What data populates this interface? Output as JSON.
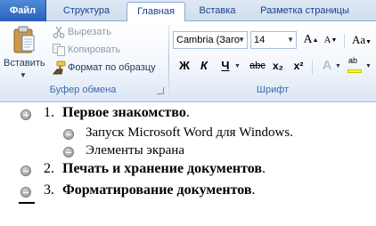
{
  "tabs": {
    "file": "Файл",
    "structure": "Структура",
    "home": "Главная",
    "insert": "Вставка",
    "page_layout": "Разметка страницы"
  },
  "clipboard": {
    "paste_label": "Вставить",
    "cut_label": "Вырезать",
    "copy_label": "Копировать",
    "format_painter_label": "Формат по образцу",
    "group_label": "Буфер обмена"
  },
  "font": {
    "font_name": "Cambria (Заго",
    "font_size": "14",
    "grow_label": "A",
    "shrink_label": "A",
    "case_label": "Aa",
    "bold_label": "Ж",
    "italic_label": "К",
    "underline_label": "Ч",
    "strike_label": "abc",
    "subscript_label": "x₂",
    "superscript_label": "x²",
    "effects_label": "A",
    "highlight_label": "ab",
    "group_label": "Шрифт"
  },
  "colors": {
    "accent": "#2a62bd",
    "highlight": "#ffff00"
  },
  "document": {
    "items": [
      {
        "num": "1.",
        "text": "Первое знакомство",
        "punct": "."
      },
      {
        "text": "Запуск Microsoft Word для Windows."
      },
      {
        "text": "Элементы экрана"
      },
      {
        "num": "2.",
        "text": "Печать и хранение документов",
        "punct": "."
      },
      {
        "num": "3.",
        "text": "Форматирование документов",
        "punct": "."
      }
    ]
  }
}
